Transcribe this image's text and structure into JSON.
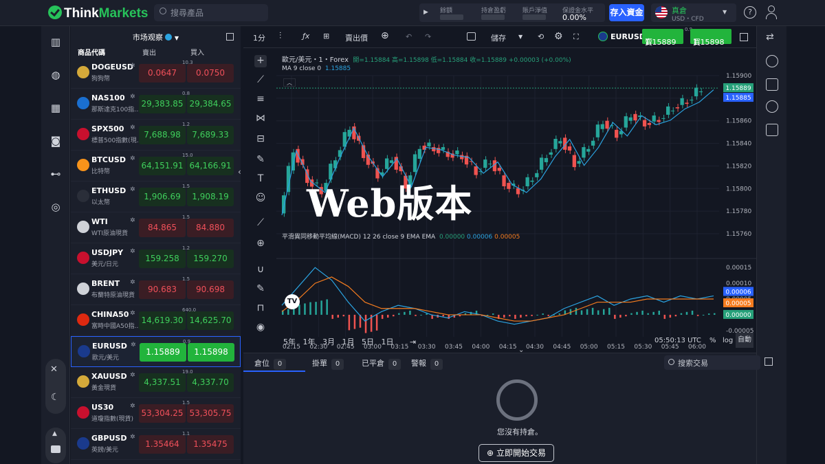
{
  "topbar": {
    "logo_think": "Think",
    "logo_markets": "Markets",
    "search_placeholder": "搜尋產品",
    "acct_fields": [
      "餘額",
      "持倉盈虧",
      "賬戶淨值",
      "保證金水平"
    ],
    "margin_level": "0.00%",
    "deposit": "存入資金",
    "account_type": "真倉",
    "account_sub": "USD・CFD"
  },
  "watchlist": {
    "title": "市场观察",
    "col_symbol": "商品代碼",
    "col_sell": "賣出",
    "col_buy": "買入",
    "rows": [
      {
        "sym": "DOGEUSD",
        "desc": "狗狗幣",
        "spread": "10.3",
        "sell": "0.0647",
        "buy": "0.0750",
        "dir": "red",
        "color": "#d4a93a"
      },
      {
        "sym": "NAS100",
        "desc": "那斯達克100指...",
        "spread": "0.8",
        "sell": "29,383.85",
        "buy": "29,384.65",
        "dir": "grn",
        "color": "#1a6fd0"
      },
      {
        "sym": "SPX500",
        "desc": "標普500指數(現...",
        "spread": "1.2",
        "sell": "7,688.98",
        "buy": "7,689.33",
        "dir": "grn",
        "color": "#c8102e"
      },
      {
        "sym": "BTCUSD",
        "desc": "比特幣",
        "spread": "15.0",
        "sell": "64,151.91",
        "buy": "64,166.91",
        "dir": "grn",
        "color": "#f7931a"
      },
      {
        "sym": "ETHUSD",
        "desc": "以太幣",
        "spread": "1.5",
        "sell": "1,906.69",
        "buy": "1,908.19",
        "dir": "grn",
        "color": "#2a2e39"
      },
      {
        "sym": "WTI",
        "desc": "WTI原油現貨",
        "spread": "1.5",
        "sell": "84.865",
        "buy": "84.880",
        "dir": "red",
        "color": "#cfd2d8"
      },
      {
        "sym": "USDJPY",
        "desc": "美元/日元",
        "spread": "1.2",
        "sell": "159.258",
        "buy": "159.270",
        "dir": "grn",
        "color": "#c8102e"
      },
      {
        "sym": "BRENT",
        "desc": "布蘭特原油現貨",
        "spread": "1.5",
        "sell": "90.683",
        "buy": "90.698",
        "dir": "red",
        "color": "#cfd2d8"
      },
      {
        "sym": "CHINA50",
        "desc": "富時中國A50指...",
        "spread": "640.0",
        "sell": "14,619.30",
        "buy": "14,625.70",
        "dir": "grn",
        "color": "#de2910"
      },
      {
        "sym": "EURUSD",
        "desc": "歐元/美元",
        "spread": "0.9",
        "sell": "1.15889",
        "buy": "1.15898",
        "dir": "sel",
        "color": "#1a3a8c"
      },
      {
        "sym": "XAUUSD",
        "desc": "黃金現貨",
        "spread": "19.0",
        "sell": "4,337.51",
        "buy": "4,337.70",
        "dir": "grn",
        "color": "#d4a93a"
      },
      {
        "sym": "US30",
        "desc": "道瓊指數(現貨)",
        "spread": "1.5",
        "sell": "53,304.25",
        "buy": "53,305.75",
        "dir": "red",
        "color": "#c8102e"
      },
      {
        "sym": "GBPUSD",
        "desc": "英鎊/美元",
        "spread": "1.1",
        "sell": "1.35464",
        "buy": "1.35475",
        "dir": "red",
        "color": "#1a3a8c"
      }
    ]
  },
  "chart_toolbar": {
    "interval": "1分",
    "bid_price": "賣出價",
    "save": "儲存",
    "symbol": "EURUSD",
    "buy_label": "賣",
    "buy_price": "1.15889",
    "sell_label": "買",
    "sell_price": "1.15898",
    "spread": "0.9"
  },
  "chart_data": [
    {
      "type": "line",
      "title": "歐元/美元・1・Forex",
      "ohlc": "開=1.15884 高=1.15898 低=1.15884 收=1.15889 +0.00003 (+0.00%)",
      "indicator": "MA 9 close 0",
      "indicator_value": "1.15885",
      "x": [
        "02:15",
        "02:30",
        "02:45",
        "03:00",
        "03:15",
        "03:30",
        "03:45",
        "04:00",
        "04:15",
        "04:30",
        "04:45",
        "05:00",
        "05:15",
        "05:30",
        "05:45",
        "06:00"
      ],
      "yticks": [
        "1.15900",
        "1.15880",
        "1.15860",
        "1.15840",
        "1.15820",
        "1.15800",
        "1.15780",
        "1.15760"
      ],
      "ylim": [
        1.1576,
        1.159
      ],
      "last_price": "1.15889",
      "ma_value": "1.15885",
      "series": [
        {
          "name": "close",
          "values": [
            1.15778,
            1.15835,
            1.15808,
            1.15798,
            1.15828,
            1.15855,
            1.1583,
            1.15812,
            1.15828,
            1.15803,
            1.15838,
            1.15836,
            1.15831,
            1.15829,
            1.15815,
            1.15825,
            1.15805,
            1.15798,
            1.1581,
            1.1583,
            1.15845,
            1.15822,
            1.15838,
            1.1586,
            1.15848,
            1.15866,
            1.15858,
            1.15862,
            1.15872,
            1.15878,
            1.15889
          ]
        }
      ]
    },
    {
      "type": "line",
      "title": "平滑異同移動平均線(MACD) 12 26 close 9 EMA EMA",
      "values_text": [
        "0.00000",
        "0.00006",
        "0.00005"
      ],
      "yticks": [
        "0.00015",
        "0.00010",
        "0.00005",
        "0.00000",
        "-0.00005"
      ],
      "ylim": [
        -7e-05,
        0.00017
      ],
      "series": [
        {
          "name": "MACD",
          "values": [
            3e-05,
            9e-05,
            0.00015,
            0.00011,
            4e-05,
            -2e-05,
            1e-05,
            3e-05,
            2e-05,
            0.0,
            -1e-05,
            1e-05,
            0.0,
            -2e-05,
            -3e-05,
            -2e-05,
            -1e-05,
            2e-05,
            4e-05,
            6e-05,
            3e-05,
            5e-05,
            6e-05,
            4e-05,
            6e-05,
            5e-05,
            6e-05
          ]
        },
        {
          "name": "Signal",
          "values": [
            1e-05,
            5e-05,
            0.0001,
            0.00012,
            9e-05,
            4e-05,
            2e-05,
            2e-05,
            2e-05,
            1e-05,
            0.0,
            0.0,
            0.0,
            -1e-05,
            -2e-05,
            -2e-05,
            -1e-05,
            0.0,
            2e-05,
            4e-05,
            4e-05,
            4e-05,
            5e-05,
            5e-05,
            5e-05,
            5e-05,
            5e-05
          ]
        }
      ],
      "tags": [
        "0.00006",
        "0.00005",
        "0.00000"
      ]
    }
  ],
  "chart_bottom": {
    "ranges": [
      "5年",
      "1年",
      "3月",
      "1月",
      "5日",
      "1日"
    ],
    "time": "05:50:13 UTC",
    "pct": "%",
    "log": "log",
    "auto": "自動"
  },
  "bottom": {
    "tabs": [
      {
        "label": "倉位",
        "count": "0"
      },
      {
        "label": "掛單",
        "count": "0"
      },
      {
        "label": "已平倉",
        "count": "0"
      },
      {
        "label": "警報",
        "count": "0"
      }
    ],
    "search_placeholder": "搜索交易",
    "empty": "您沒有持倉。",
    "start_btn": "立即開始交易"
  },
  "overlay": {
    "watermark": "Web版本"
  }
}
